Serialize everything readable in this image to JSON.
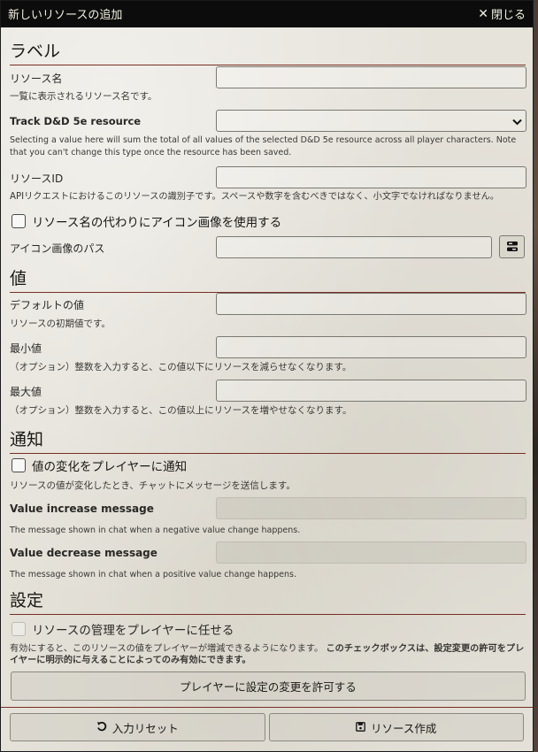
{
  "dialog": {
    "title": "新しいリソースの追加",
    "close_label": "閉じる",
    "close_icon": "close-icon"
  },
  "label_section": {
    "heading": "ラベル",
    "resource_name": {
      "label": "リソース名",
      "hint": "一覧に表示されるリソース名です。",
      "value": ""
    },
    "track_dnd": {
      "label": "Track D&D 5e resource",
      "selected": "",
      "hint": "Selecting a value here will sum the total of all values of the selected D&D 5e resource across all player characters. Note that you can't change this type once the resource has been saved."
    },
    "resource_id": {
      "label": "リソースID",
      "hint": "APIリクエストにおけるこのリソースの識別子です。スペースや数字を含むべきではなく、小文字でなければなりません。",
      "value": ""
    },
    "use_icon": {
      "label": "リソース名の代わりにアイコン画像を使用する",
      "checked": false
    },
    "icon_path": {
      "label": "アイコン画像のパス",
      "value": ""
    }
  },
  "value_section": {
    "heading": "値",
    "default_value": {
      "label": "デフォルトの値",
      "hint": "リソースの初期値です。",
      "value": ""
    },
    "min_value": {
      "label": "最小値",
      "hint": "（オプション）整数を入力すると、この値以下にリソースを減らせなくなります。",
      "value": ""
    },
    "max_value": {
      "label": "最大値",
      "hint": "（オプション）整数を入力すると、この値以上にリソースを増やせなくなります。",
      "value": ""
    }
  },
  "notify_section": {
    "heading": "通知",
    "notify_players": {
      "label": "値の変化をプレイヤーに通知",
      "checked": false,
      "hint": "リソースの値が変化したとき、チャットにメッセージを送信します。"
    },
    "increase_message": {
      "label": "Value increase message",
      "hint": "The message shown in chat when a negative value change happens.",
      "value": ""
    },
    "decrease_message": {
      "label": "Value decrease message",
      "hint": "The message shown in chat when a positive value change happens.",
      "value": ""
    }
  },
  "settings_section": {
    "heading": "設定",
    "player_managed": {
      "label": "リソースの管理をプレイヤーに任せる",
      "checked": false,
      "hint_normal": "有効にすると、このリソースの値をプレイヤーが増減できるようになります。",
      "hint_bold": "このチェックボックスは、設定変更の許可をプレイヤーに明示的に与えることによってのみ有効にできます。"
    },
    "allow_button": "プレイヤーに設定の変更を許可する"
  },
  "footer": {
    "reset_label": "入力リセット",
    "reset_icon": "undo-icon",
    "create_label": "リソース作成",
    "create_icon": "save-icon"
  },
  "colors": {
    "titlebar": "#0c0c0c",
    "accent_rule": "#782e22",
    "panel": "#e6e3db"
  }
}
